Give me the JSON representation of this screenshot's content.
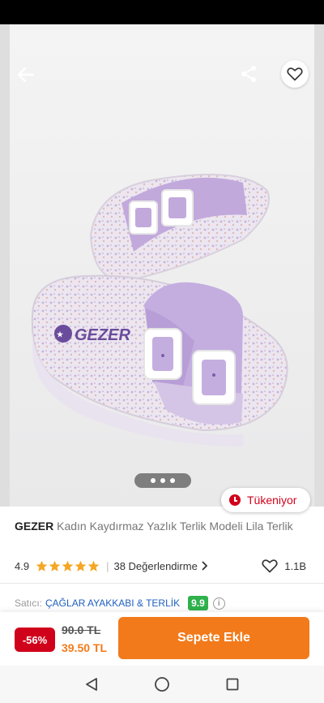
{
  "hero": {
    "icons": {
      "back": "arrow-left-icon",
      "share": "share-icon",
      "favorite": "heart-outline-icon"
    },
    "gallery_dots": 3,
    "printed_brand": "GEZER"
  },
  "stock_badge": {
    "label": "Tükeniyor",
    "icon": "clock-icon",
    "color": "#d0021b"
  },
  "product": {
    "brand": "GEZER",
    "name": "Kadın Kaydırmaz Yazlık Terlik Modeli Lila Terlik"
  },
  "rating": {
    "value": "4.9",
    "stars": 5,
    "star_color": "#f5a623",
    "reviews": "38 Değerlendirme",
    "likes": "1.1B"
  },
  "seller": {
    "label": "Satıcı:",
    "name": "ÇAĞLAR AYAKKABI & TERLİK",
    "score": "9.9",
    "score_color": "#2fb14c"
  },
  "buy_bar": {
    "discount": "-56%",
    "old_price": "90.0 TL",
    "new_price": "39.50 TL",
    "cart_label": "Sepete Ekle",
    "accent": "#f27a1a"
  },
  "nav": {
    "icons": [
      "back-triangle-icon",
      "home-circle-icon",
      "recents-square-icon"
    ]
  }
}
